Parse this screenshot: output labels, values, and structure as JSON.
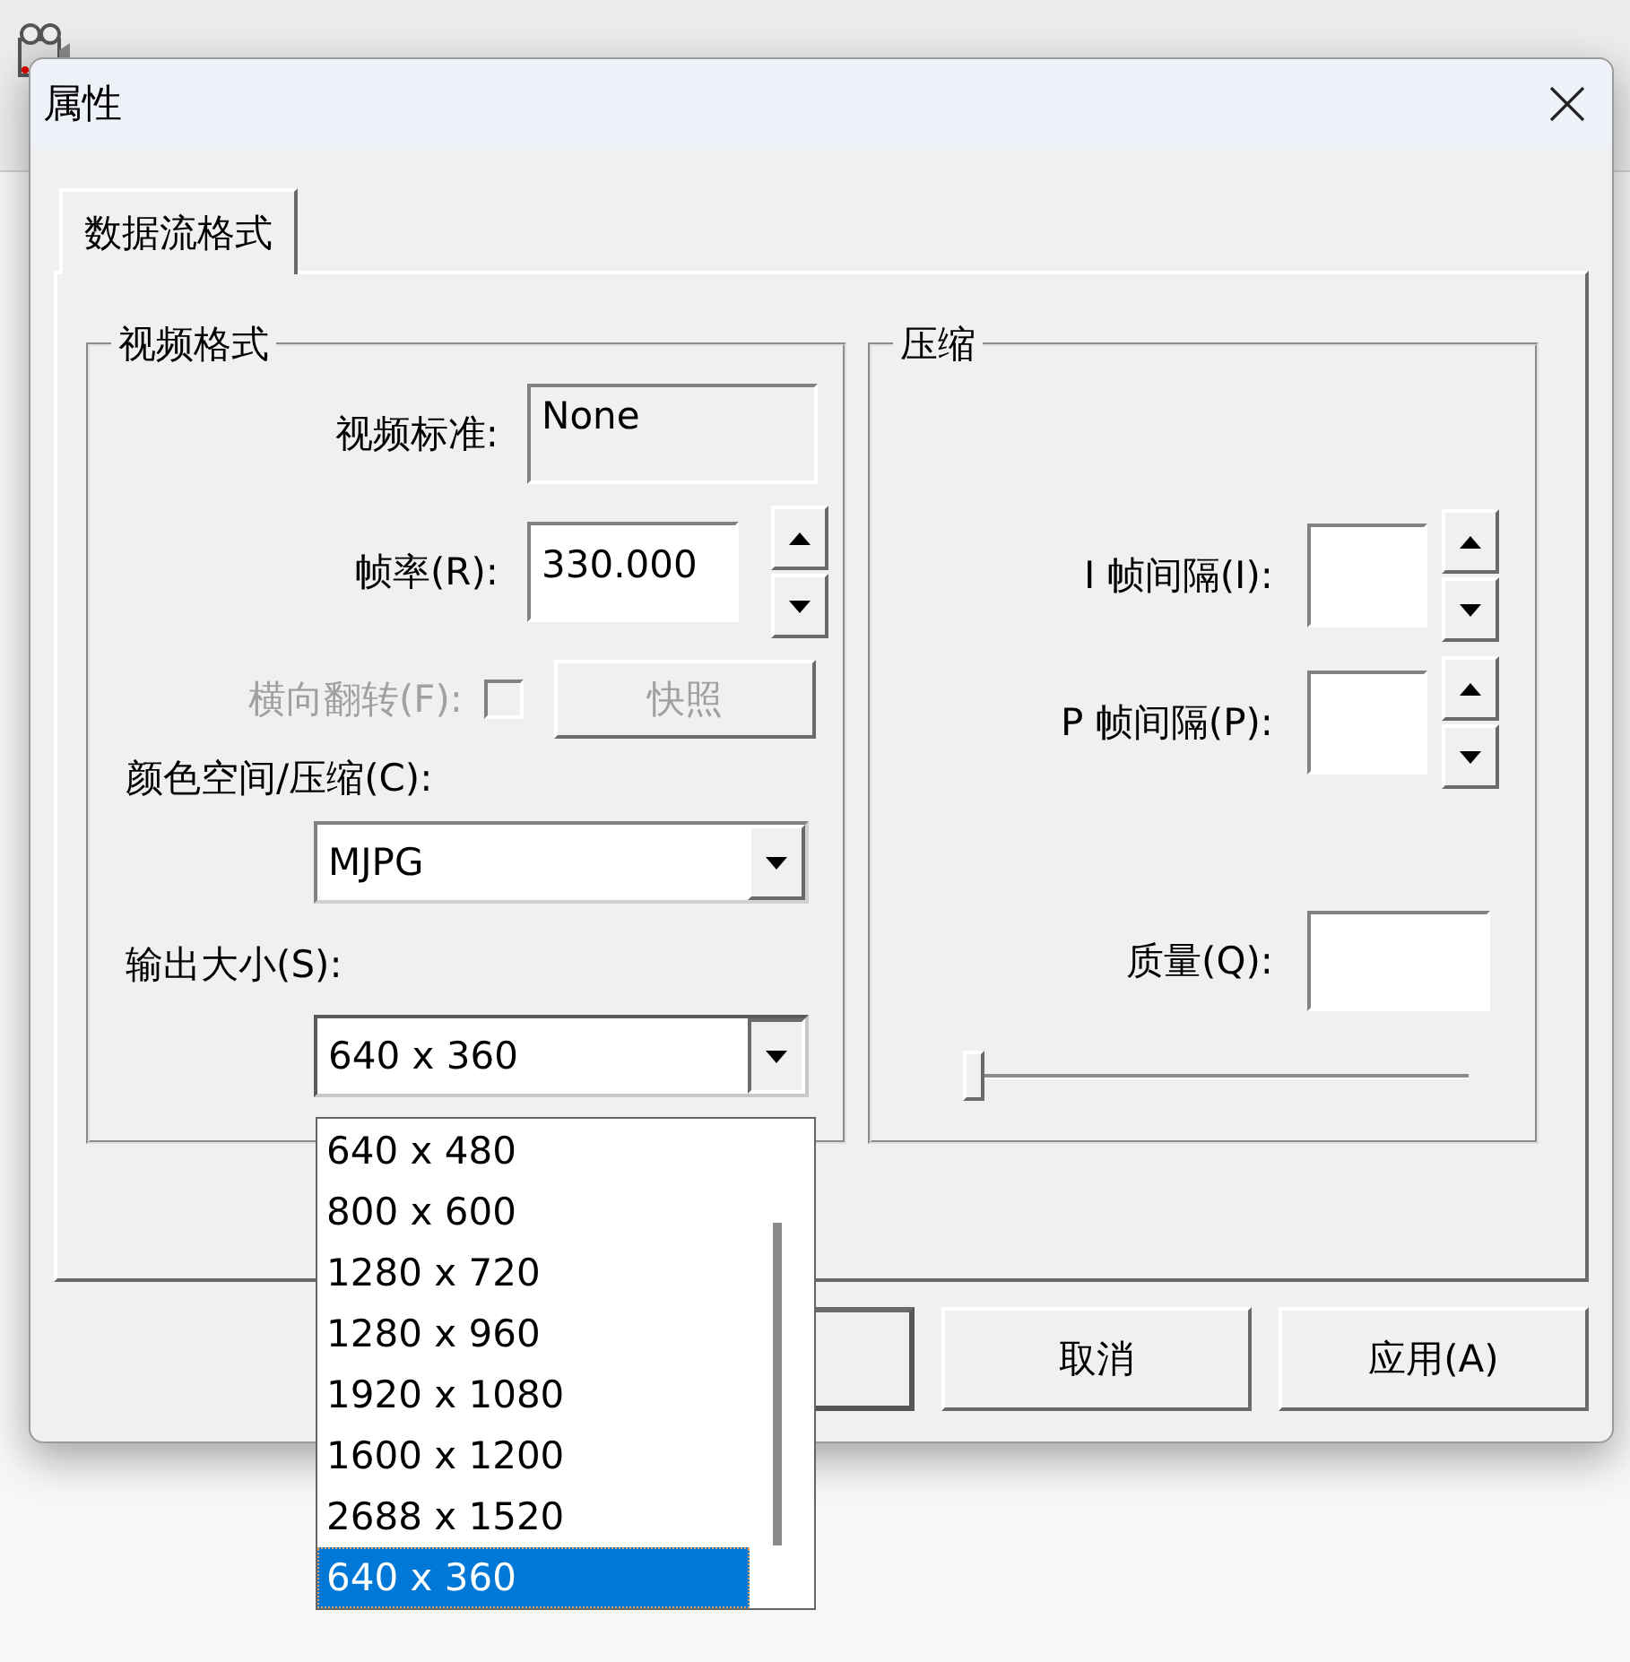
{
  "dialog": {
    "title": "属性"
  },
  "tabs": [
    {
      "label": "数据流格式",
      "selected": true
    }
  ],
  "video_format": {
    "title": "视频格式",
    "video_standard": {
      "label": "视频标准:",
      "value": "None"
    },
    "frame_rate": {
      "label": "帧率(R):",
      "value": "330.000"
    },
    "flip_horizontal": {
      "label": "横向翻转(F):",
      "checked": false,
      "disabled": true
    },
    "snapshot_button": {
      "label": "快照",
      "disabled": true
    },
    "color_space": {
      "label": "颜色空间/压缩(C):",
      "value": "MJPG"
    },
    "output_size": {
      "label": "输出大小(S):",
      "value": "640 x 360",
      "expanded": true,
      "options": [
        {
          "label": "640 x 480",
          "selected": false
        },
        {
          "label": "800 x 600",
          "selected": false
        },
        {
          "label": "1280 x 720",
          "selected": false
        },
        {
          "label": "1280 x 960",
          "selected": false
        },
        {
          "label": "1920 x 1080",
          "selected": false
        },
        {
          "label": "1600 x 1200",
          "selected": false
        },
        {
          "label": "2688 x 1520",
          "selected": false
        },
        {
          "label": "640 x 360",
          "selected": true
        }
      ]
    }
  },
  "compression": {
    "title": "压缩",
    "i_frame_interval": {
      "label": "I 帧间隔(I):"
    },
    "p_frame_interval": {
      "label": "P 帧间隔(P):"
    },
    "quality": {
      "label": "质量(Q):",
      "level": 0
    }
  },
  "buttons": [
    {
      "label": "取消"
    },
    {
      "label": "应用(A)"
    }
  ]
}
